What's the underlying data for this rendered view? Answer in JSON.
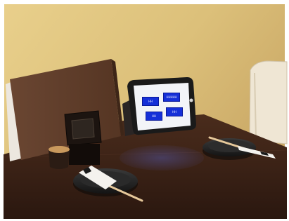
{
  "scene": {
    "tablet": {
      "buttons": [
        {
          "label": "HH"
        },
        {
          "label": "HHHHH"
        },
        {
          "label": "HH"
        },
        {
          "label": "HH"
        }
      ],
      "colors": {
        "button": "#1530d8",
        "screen": "#f2f4f8",
        "frame": "#1a1a1a"
      }
    },
    "colors": {
      "wall": "#e8cf8a",
      "table": "#3a2418",
      "menu_board": "#5a3a28"
    }
  }
}
